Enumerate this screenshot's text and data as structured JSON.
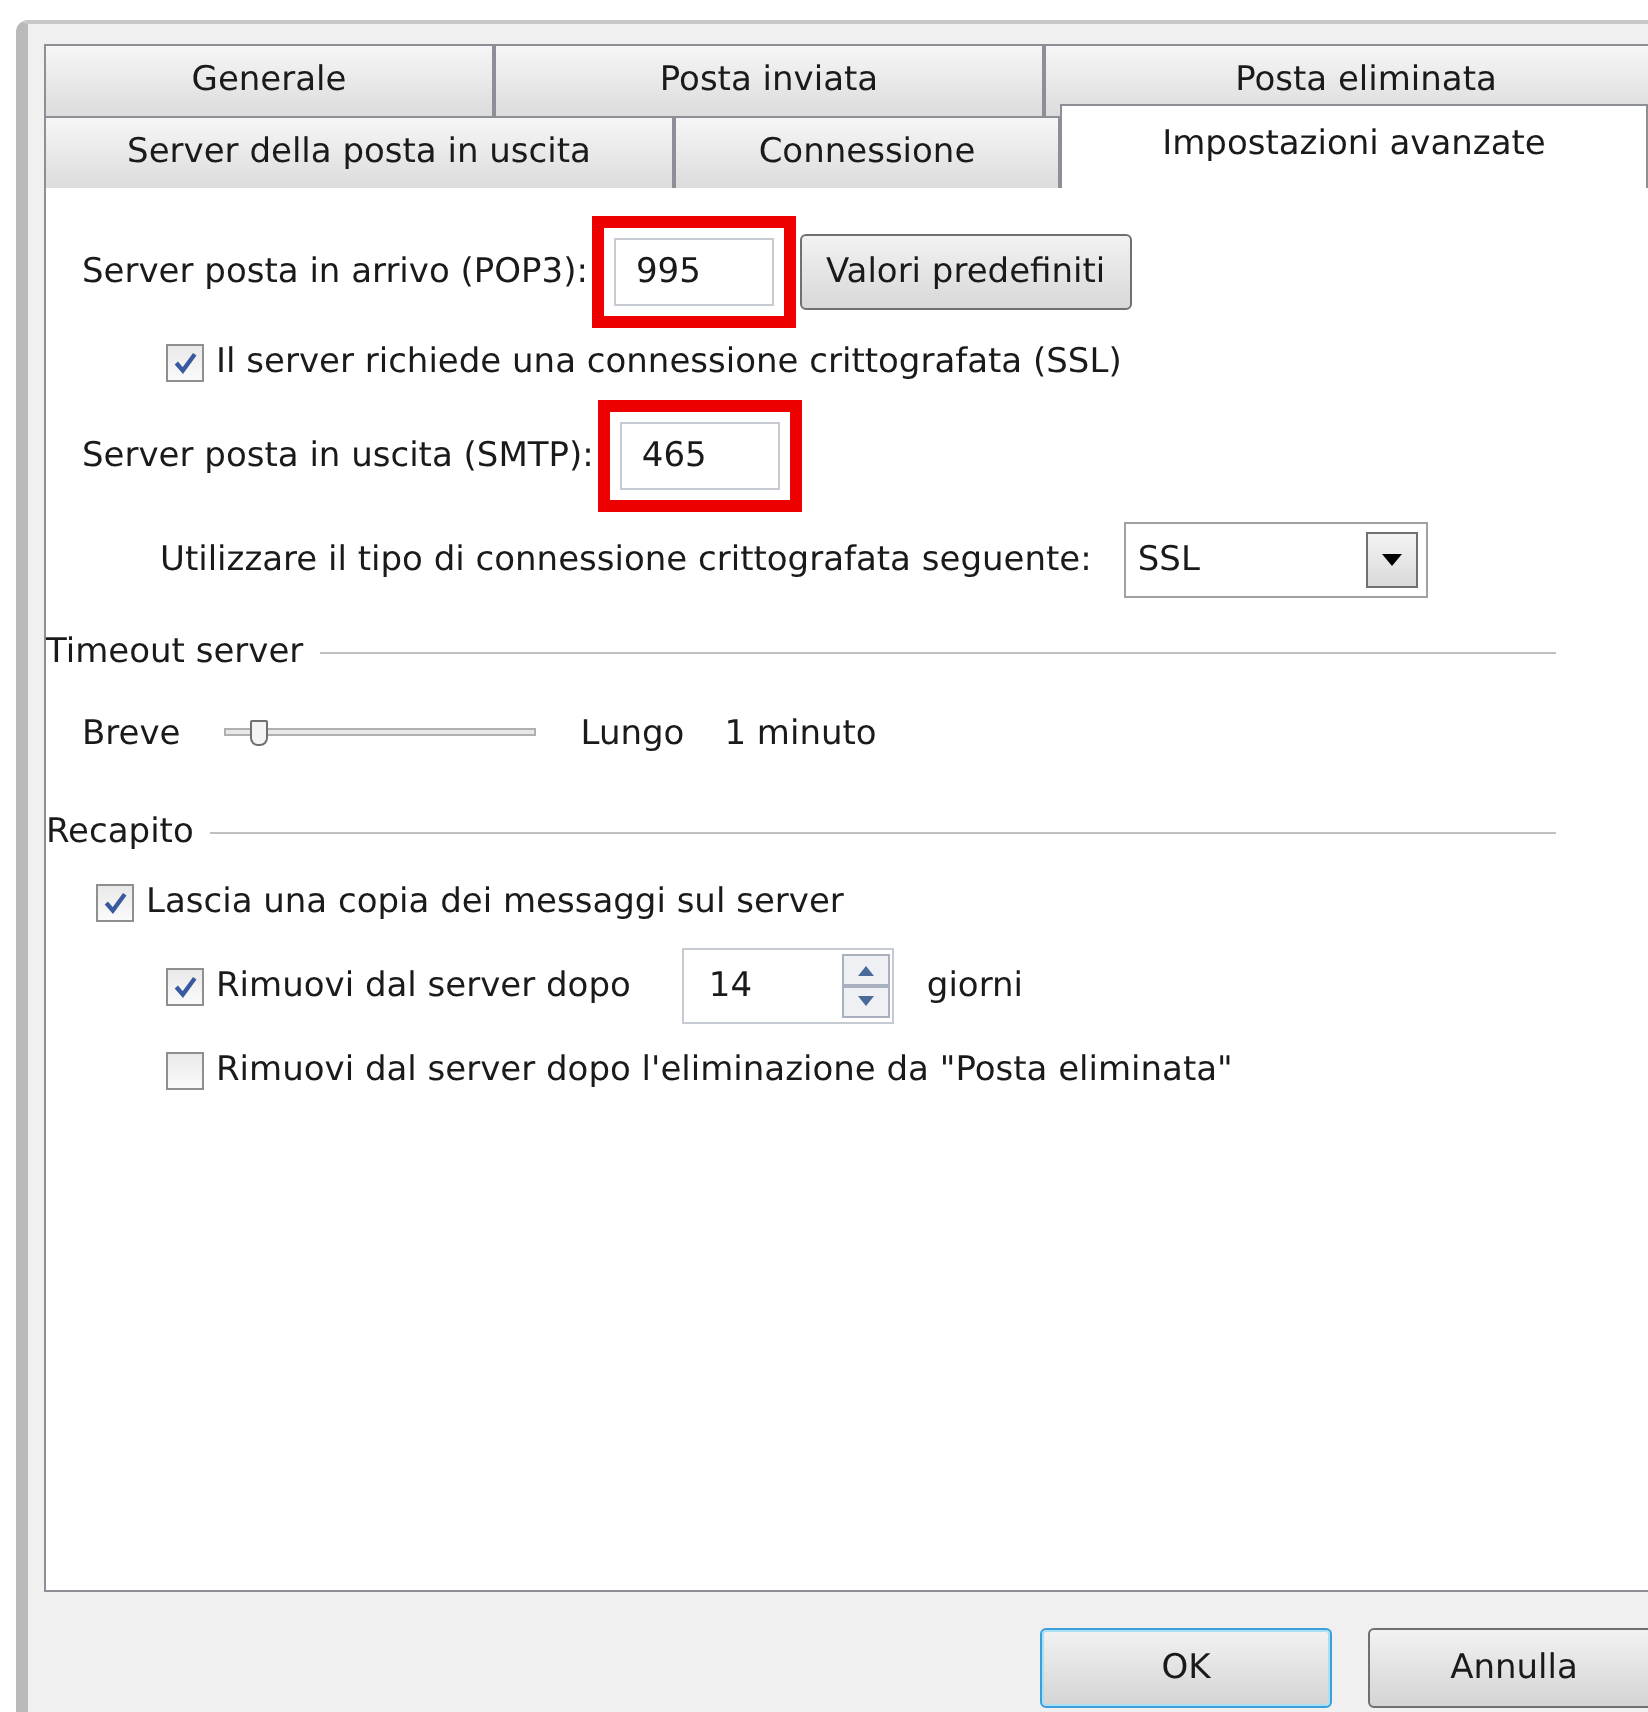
{
  "tab_rows": [
    {
      "tabs": [
        {
          "label": "Generale",
          "selected": false
        },
        {
          "label": "Posta inviata",
          "selected": false
        },
        {
          "label": "Posta eliminata",
          "selected": false
        }
      ]
    },
    {
      "tabs": [
        {
          "label": "Server della posta in uscita",
          "selected": false
        },
        {
          "label": "Connessione",
          "selected": false
        },
        {
          "label": "Impostazioni avanzate",
          "selected": true
        }
      ]
    }
  ],
  "incoming": {
    "label": "Server posta in arrivo (POP3):",
    "value": "995",
    "highlighted": true,
    "button": "Valori predefiniti"
  },
  "ssl_checkbox": {
    "label": "Il server richiede una connessione crittografata (SSL)",
    "checked": true
  },
  "outgoing": {
    "label": "Server posta in uscita (SMTP):",
    "value": "465",
    "highlighted": true
  },
  "encryption": {
    "label": "Utilizzare il tipo di connessione crittografata seguente:",
    "value": "SSL"
  },
  "timeout": {
    "title": "Timeout server",
    "min_label": "Breve",
    "max_label": "Lungo",
    "reading": "1 minuto",
    "level": 0.08
  },
  "delivery": {
    "title": "Recapito",
    "options": [
      {
        "kind": "checkbox",
        "label": "Lascia una copia dei messaggi sul server",
        "checked": true,
        "nested": false
      },
      {
        "kind": "spinner",
        "label": "Rimuovi dal server dopo",
        "checked": true,
        "nested": true,
        "value": "14",
        "unit": "giorni"
      },
      {
        "kind": "checkbox",
        "label": "Rimuovi dal server dopo l'eliminazione da \"Posta eliminata\"",
        "checked": false,
        "nested": true
      }
    ]
  },
  "buttons": [
    {
      "label": "OK",
      "default": true
    },
    {
      "label": "Annulla",
      "default": false
    }
  ]
}
